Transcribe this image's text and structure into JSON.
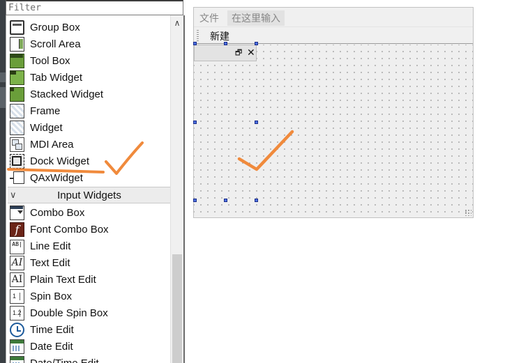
{
  "widget_box": {
    "filter_placeholder": "Filter",
    "items": [
      {
        "label": "Group Box",
        "icon": "group-box-icon"
      },
      {
        "label": "Scroll Area",
        "icon": "scroll-area-icon"
      },
      {
        "label": "Tool Box",
        "icon": "tool-box-icon"
      },
      {
        "label": "Tab Widget",
        "icon": "tab-widget-icon"
      },
      {
        "label": "Stacked Widget",
        "icon": "stacked-widget-icon"
      },
      {
        "label": "Frame",
        "icon": "frame-icon"
      },
      {
        "label": "Widget",
        "icon": "widget-icon"
      },
      {
        "label": "MDI Area",
        "icon": "mdi-area-icon"
      },
      {
        "label": "Dock Widget",
        "icon": "dock-widget-icon"
      },
      {
        "label": "QAxWidget",
        "icon": "qaxwidget-icon"
      }
    ],
    "category": {
      "label": "Input Widgets",
      "icon": "chevron-down-icon"
    },
    "input_items": [
      {
        "label": "Combo Box",
        "icon": "combo-box-icon"
      },
      {
        "label": "Font Combo Box",
        "icon": "font-combo-box-icon"
      },
      {
        "label": "Line Edit",
        "icon": "line-edit-icon"
      },
      {
        "label": "Text Edit",
        "icon": "text-edit-icon"
      },
      {
        "label": "Plain Text Edit",
        "icon": "plain-text-edit-icon"
      },
      {
        "label": "Spin Box",
        "icon": "spin-box-icon"
      },
      {
        "label": "Double Spin Box",
        "icon": "double-spin-box-icon"
      },
      {
        "label": "Time Edit",
        "icon": "time-edit-icon"
      },
      {
        "label": "Date Edit",
        "icon": "date-edit-icon"
      },
      {
        "label": "Date/Time Edit",
        "icon": "date-time-edit-icon"
      }
    ],
    "icon_glyphs": {
      "font": "f",
      "line": "AB|",
      "text": "AI",
      "plain": "AI",
      "spin": "1",
      "double_spin": "1.2"
    }
  },
  "form": {
    "menu": {
      "file": "文件",
      "input_here": "在这里输入"
    },
    "toolbar": {
      "new": "新建"
    },
    "dock": {
      "float_icon": "🗗",
      "close_icon": "✕"
    }
  },
  "colors": {
    "annotation": "#f08a3c",
    "selection_handle": "#4a6fe0"
  }
}
